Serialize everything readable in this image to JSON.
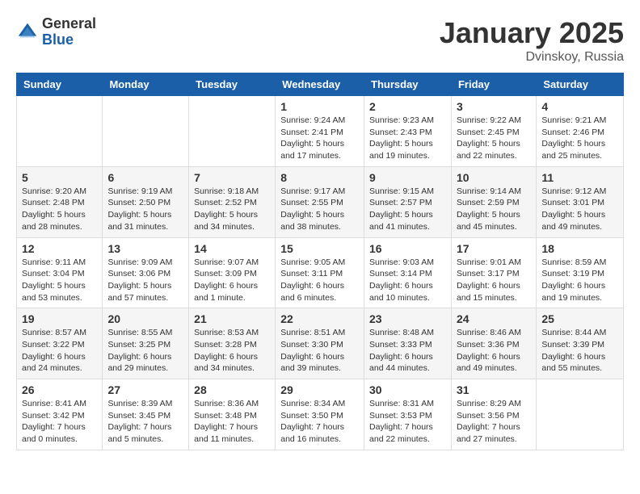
{
  "logo": {
    "general": "General",
    "blue": "Blue"
  },
  "title": "January 2025",
  "location": "Dvinskoy, Russia",
  "days_of_week": [
    "Sunday",
    "Monday",
    "Tuesday",
    "Wednesday",
    "Thursday",
    "Friday",
    "Saturday"
  ],
  "weeks": [
    [
      {
        "day": "",
        "info": ""
      },
      {
        "day": "",
        "info": ""
      },
      {
        "day": "",
        "info": ""
      },
      {
        "day": "1",
        "info": "Sunrise: 9:24 AM\nSunset: 2:41 PM\nDaylight: 5 hours\nand 17 minutes."
      },
      {
        "day": "2",
        "info": "Sunrise: 9:23 AM\nSunset: 2:43 PM\nDaylight: 5 hours\nand 19 minutes."
      },
      {
        "day": "3",
        "info": "Sunrise: 9:22 AM\nSunset: 2:45 PM\nDaylight: 5 hours\nand 22 minutes."
      },
      {
        "day": "4",
        "info": "Sunrise: 9:21 AM\nSunset: 2:46 PM\nDaylight: 5 hours\nand 25 minutes."
      }
    ],
    [
      {
        "day": "5",
        "info": "Sunrise: 9:20 AM\nSunset: 2:48 PM\nDaylight: 5 hours\nand 28 minutes."
      },
      {
        "day": "6",
        "info": "Sunrise: 9:19 AM\nSunset: 2:50 PM\nDaylight: 5 hours\nand 31 minutes."
      },
      {
        "day": "7",
        "info": "Sunrise: 9:18 AM\nSunset: 2:52 PM\nDaylight: 5 hours\nand 34 minutes."
      },
      {
        "day": "8",
        "info": "Sunrise: 9:17 AM\nSunset: 2:55 PM\nDaylight: 5 hours\nand 38 minutes."
      },
      {
        "day": "9",
        "info": "Sunrise: 9:15 AM\nSunset: 2:57 PM\nDaylight: 5 hours\nand 41 minutes."
      },
      {
        "day": "10",
        "info": "Sunrise: 9:14 AM\nSunset: 2:59 PM\nDaylight: 5 hours\nand 45 minutes."
      },
      {
        "day": "11",
        "info": "Sunrise: 9:12 AM\nSunset: 3:01 PM\nDaylight: 5 hours\nand 49 minutes."
      }
    ],
    [
      {
        "day": "12",
        "info": "Sunrise: 9:11 AM\nSunset: 3:04 PM\nDaylight: 5 hours\nand 53 minutes."
      },
      {
        "day": "13",
        "info": "Sunrise: 9:09 AM\nSunset: 3:06 PM\nDaylight: 5 hours\nand 57 minutes."
      },
      {
        "day": "14",
        "info": "Sunrise: 9:07 AM\nSunset: 3:09 PM\nDaylight: 6 hours\nand 1 minute."
      },
      {
        "day": "15",
        "info": "Sunrise: 9:05 AM\nSunset: 3:11 PM\nDaylight: 6 hours\nand 6 minutes."
      },
      {
        "day": "16",
        "info": "Sunrise: 9:03 AM\nSunset: 3:14 PM\nDaylight: 6 hours\nand 10 minutes."
      },
      {
        "day": "17",
        "info": "Sunrise: 9:01 AM\nSunset: 3:17 PM\nDaylight: 6 hours\nand 15 minutes."
      },
      {
        "day": "18",
        "info": "Sunrise: 8:59 AM\nSunset: 3:19 PM\nDaylight: 6 hours\nand 19 minutes."
      }
    ],
    [
      {
        "day": "19",
        "info": "Sunrise: 8:57 AM\nSunset: 3:22 PM\nDaylight: 6 hours\nand 24 minutes."
      },
      {
        "day": "20",
        "info": "Sunrise: 8:55 AM\nSunset: 3:25 PM\nDaylight: 6 hours\nand 29 minutes."
      },
      {
        "day": "21",
        "info": "Sunrise: 8:53 AM\nSunset: 3:28 PM\nDaylight: 6 hours\nand 34 minutes."
      },
      {
        "day": "22",
        "info": "Sunrise: 8:51 AM\nSunset: 3:30 PM\nDaylight: 6 hours\nand 39 minutes."
      },
      {
        "day": "23",
        "info": "Sunrise: 8:48 AM\nSunset: 3:33 PM\nDaylight: 6 hours\nand 44 minutes."
      },
      {
        "day": "24",
        "info": "Sunrise: 8:46 AM\nSunset: 3:36 PM\nDaylight: 6 hours\nand 49 minutes."
      },
      {
        "day": "25",
        "info": "Sunrise: 8:44 AM\nSunset: 3:39 PM\nDaylight: 6 hours\nand 55 minutes."
      }
    ],
    [
      {
        "day": "26",
        "info": "Sunrise: 8:41 AM\nSunset: 3:42 PM\nDaylight: 7 hours\nand 0 minutes."
      },
      {
        "day": "27",
        "info": "Sunrise: 8:39 AM\nSunset: 3:45 PM\nDaylight: 7 hours\nand 5 minutes."
      },
      {
        "day": "28",
        "info": "Sunrise: 8:36 AM\nSunset: 3:48 PM\nDaylight: 7 hours\nand 11 minutes."
      },
      {
        "day": "29",
        "info": "Sunrise: 8:34 AM\nSunset: 3:50 PM\nDaylight: 7 hours\nand 16 minutes."
      },
      {
        "day": "30",
        "info": "Sunrise: 8:31 AM\nSunset: 3:53 PM\nDaylight: 7 hours\nand 22 minutes."
      },
      {
        "day": "31",
        "info": "Sunrise: 8:29 AM\nSunset: 3:56 PM\nDaylight: 7 hours\nand 27 minutes."
      },
      {
        "day": "",
        "info": ""
      }
    ]
  ]
}
